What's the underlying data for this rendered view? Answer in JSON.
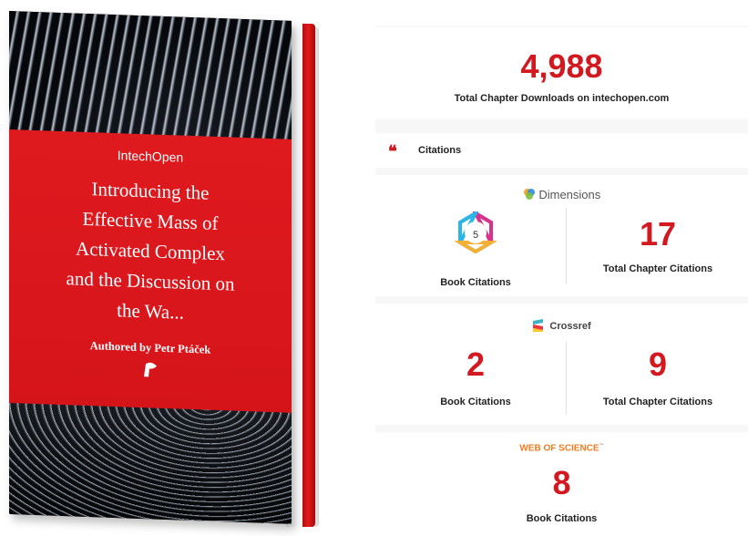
{
  "book": {
    "publisher": "IntechOpen",
    "title_lines": [
      "Introducing the",
      "Effective Mass of",
      "Activated Complex",
      "and the Discussion on",
      "the Wa..."
    ],
    "author": "Authored by Petr Ptáček"
  },
  "downloads": {
    "count": "4,988",
    "label": "Total Chapter Downloads on intechopen.com"
  },
  "citations": {
    "header": "Citations",
    "dimensions": {
      "brand": "Dimensions",
      "badge_value": "5",
      "book_label": "Book Citations",
      "chapter_value": "17",
      "chapter_label": "Total Chapter Citations"
    },
    "crossref": {
      "brand": "Crossref",
      "book_value": "2",
      "book_label": "Book Citations",
      "chapter_value": "9",
      "chapter_label": "Total Chapter Citations"
    },
    "web_of_science": {
      "brand": "WEB OF SCIENCE",
      "tm": "™",
      "book_value": "8",
      "book_label": "Book Citations"
    }
  },
  "colors": {
    "accent": "#d31920",
    "wos": "#ef7d22"
  }
}
